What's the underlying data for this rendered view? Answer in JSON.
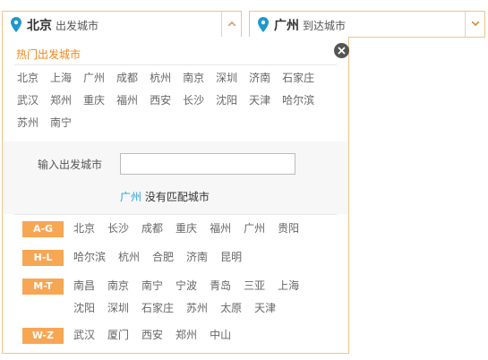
{
  "from": {
    "city": "北京",
    "sub": "出发城市"
  },
  "to": {
    "city": "广州",
    "sub": "到达城市"
  },
  "panel": {
    "hot_title": "热门出发城市",
    "hot_cities": [
      "北京",
      "上海",
      "广州",
      "成都",
      "杭州",
      "南京",
      "深圳",
      "济南",
      "石家庄",
      "武汉",
      "郑州",
      "重庆",
      "福州",
      "西安",
      "长沙",
      "沈阳",
      "天津",
      "哈尔滨",
      "苏州",
      "南宁"
    ],
    "input_label": "输入出发城市",
    "input_value": "",
    "nomatch_city": "广州",
    "nomatch_text": " 没有匹配城市",
    "groups": [
      {
        "tag": "A-G",
        "cities": [
          "北京",
          "长沙",
          "成都",
          "重庆",
          "福州",
          "广州",
          "贵阳"
        ]
      },
      {
        "tag": "H-L",
        "cities": [
          "哈尔滨",
          "杭州",
          "合肥",
          "济南",
          "昆明"
        ]
      },
      {
        "tag": "M-T",
        "cities": [
          "南昌",
          "南京",
          "南宁",
          "宁波",
          "青岛",
          "三亚",
          "上海",
          "沈阳",
          "深圳",
          "石家庄",
          "苏州",
          "太原",
          "天津"
        ]
      },
      {
        "tag": "W-Z",
        "cities": [
          "武汉",
          "厦门",
          "西安",
          "郑州",
          "中山"
        ]
      }
    ]
  },
  "colors": {
    "accent": "#f08519",
    "tag_bg": "#f7a654",
    "pin": "#1d96cf",
    "link_blue": "#2e9fd8",
    "border": "#f0c488"
  },
  "icons": {
    "pin": "location-pin-icon",
    "close": "close-icon",
    "arrow_up": "chevron-up-icon",
    "arrow_down": "chevron-down-icon"
  }
}
